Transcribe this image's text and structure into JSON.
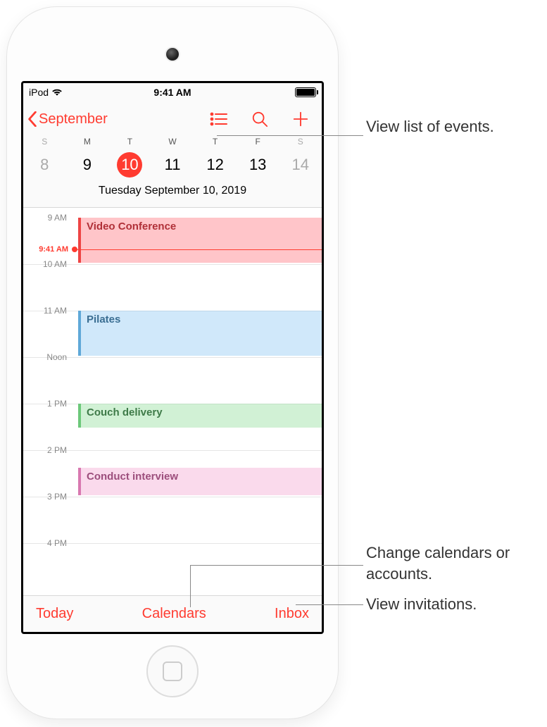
{
  "status": {
    "carrier": "iPod",
    "time": "9:41 AM"
  },
  "nav": {
    "back_label": "September"
  },
  "week": {
    "day_abbrevs": [
      "S",
      "M",
      "T",
      "W",
      "T",
      "F",
      "S"
    ],
    "day_numbers": [
      "8",
      "9",
      "10",
      "11",
      "12",
      "13",
      "14"
    ],
    "selected_index": 2,
    "date_label": "Tuesday   September 10, 2019"
  },
  "hours": [
    "9 AM",
    "10 AM",
    "11 AM",
    "Noon",
    "1 PM",
    "2 PM",
    "3 PM",
    "4 PM"
  ],
  "now": {
    "label": "9:41 AM",
    "offset_hours": 0.68
  },
  "events": [
    {
      "title": "Video Conference",
      "start": 0.0,
      "duration": 1.0,
      "color": "ev-red"
    },
    {
      "title": "Pilates",
      "start": 2.0,
      "duration": 1.0,
      "color": "ev-blue"
    },
    {
      "title": "Couch delivery",
      "start": 4.0,
      "duration": 0.55,
      "color": "ev-green"
    },
    {
      "title": "Conduct interview",
      "start": 5.38,
      "duration": 0.62,
      "color": "ev-pink"
    }
  ],
  "toolbar": {
    "today": "Today",
    "calendars": "Calendars",
    "inbox": "Inbox"
  },
  "callouts": {
    "list_view": "View list of events.",
    "calendars": "Change calendars or accounts.",
    "inbox": "View invitations."
  }
}
